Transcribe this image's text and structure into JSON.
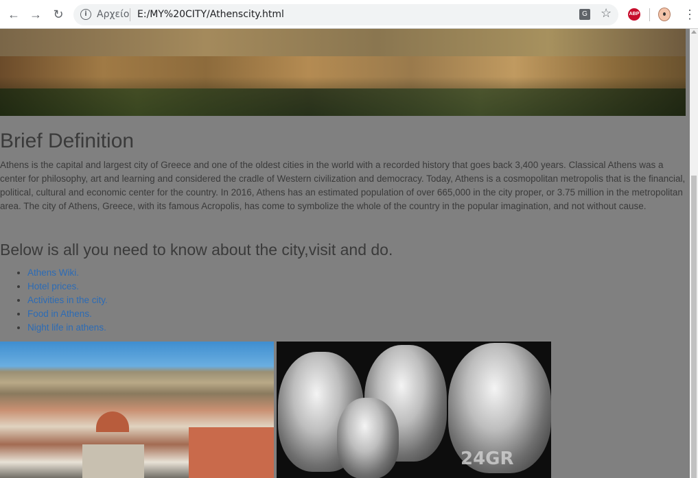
{
  "browser": {
    "scheme_label": "Αρχείο",
    "url": "E:/MY%20CITY/Athenscity.html",
    "icons": {
      "back": "back-arrow-icon",
      "forward": "forward-arrow-icon",
      "reload": "reload-icon",
      "info": "info-icon",
      "translate": "translate-icon",
      "bookmark": "star-icon",
      "adblock": "adblock-plus-icon",
      "profile": "profile-avatar-icon",
      "menu": "kebab-menu-icon"
    },
    "adblock_label": "ABP"
  },
  "page": {
    "title": "Brief Definition",
    "intro": "Athens is the capital and largest city of Greece and one of the oldest cities in the world with a recorded history that goes back 3,400 years. Classical Athens was a center for philosophy, art and learning and considered the cradle of Western civilization and democracy. Today, Athens is a cosmopolitan metropolis that is the financial, political, cultural and economic center for the country. In 2016, Athens has an estimated population of over 665,000 in the city proper, or 3.75 million in the metropolitan area. The city of Athens, Greece, with its famous Acropolis, has come to symbolize the whole of the country in the popular imagination, and not without cause.",
    "subtitle": "Below is all you need to know about the city,visit and do.",
    "links": [
      "Athens Wiki.",
      "Hotel prices.",
      "Activities in the city.",
      "Food in Athens.",
      "Night life in athens."
    ],
    "watermark": "24GR"
  },
  "colors": {
    "page_background": "#808080",
    "text": "#3a3a3a",
    "link": "#2c6bb5"
  }
}
